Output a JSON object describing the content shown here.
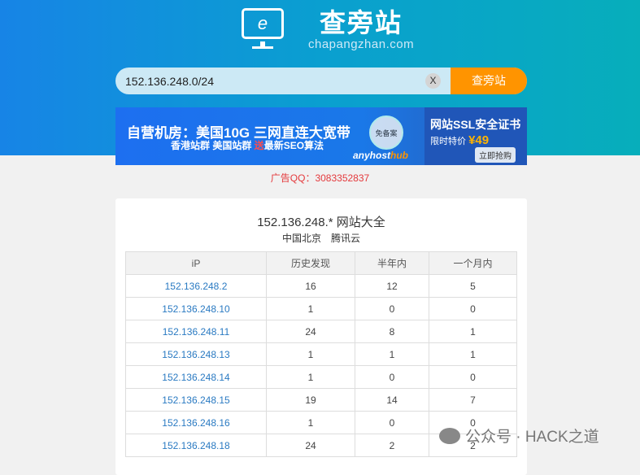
{
  "logo": {
    "cn": "查旁站",
    "en": "chapangzhan.com"
  },
  "search": {
    "value": "152.136.248.0/24",
    "clear": "X",
    "button": "查旁站"
  },
  "ad": {
    "line1": "自营机房：美国10G 三网直连大宽带",
    "line2a": "香港站群 美国站群 ",
    "line2b": "送",
    "line2c": "最新SEO算法",
    "badge": "免备案",
    "brand_a": "anyhost",
    "brand_b": "hub",
    "r1": "网站SSL安全证书",
    "r2": "限时特价 ",
    "price": "¥49",
    "cta": "立即抢购"
  },
  "ad_qq": "广告QQ：3083352837",
  "result": {
    "title": "152.136.248.* 网站大全",
    "location": "中国北京",
    "isp": "腾讯云",
    "headers": [
      "iP",
      "历史发现",
      "半年内",
      "一个月内"
    ],
    "rows": [
      [
        "152.136.248.2",
        "16",
        "12",
        "5"
      ],
      [
        "152.136.248.10",
        "1",
        "0",
        "0"
      ],
      [
        "152.136.248.11",
        "24",
        "8",
        "1"
      ],
      [
        "152.136.248.13",
        "1",
        "1",
        "1"
      ],
      [
        "152.136.248.14",
        "1",
        "0",
        "0"
      ],
      [
        "152.136.248.15",
        "19",
        "14",
        "7"
      ],
      [
        "152.136.248.16",
        "1",
        "0",
        "0"
      ],
      [
        "152.136.248.18",
        "24",
        "2",
        "2"
      ]
    ]
  },
  "watermark": "公众号 · HACK之道"
}
